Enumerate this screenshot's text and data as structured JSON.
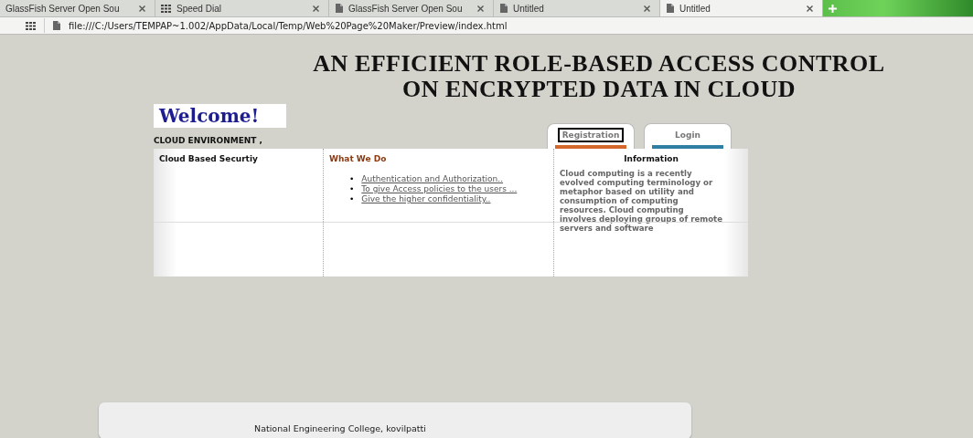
{
  "browser": {
    "tabs": [
      {
        "label": "GlassFish Server Open Sou",
        "kind": "plain",
        "selected": false
      },
      {
        "label": "Speed Dial",
        "kind": "dial",
        "selected": false
      },
      {
        "label": "GlassFish Server Open Sou",
        "kind": "page",
        "selected": false
      },
      {
        "label": "Untitled",
        "kind": "page",
        "selected": false
      },
      {
        "label": "Untitled",
        "kind": "page",
        "selected": true
      }
    ],
    "address": "file:///C:/Users/TEMPAP~1.002/AppData/Local/Temp/Web%20Page%20Maker/Preview/index.html"
  },
  "page": {
    "title_lines": [
      "AN EFFICIENT ROLE-BASED ACCESS CONTROL",
      "ON ENCRYPTED DATA IN CLOUD"
    ],
    "welcome": "Welcome!",
    "subtitle": "CLOUD ENVIRONMENT ,",
    "nav_tabs": [
      {
        "label": "Registration",
        "selected": true
      },
      {
        "label": "Login",
        "selected": false
      }
    ],
    "columns": [
      {
        "heading": "Cloud Based Securtiy"
      },
      {
        "heading": "What We Do",
        "links": [
          {
            "bullet": "•",
            "text": "Authentication and Authorization.."
          },
          {
            "bullet": "•",
            "text": "To give Access policies to the users ..."
          },
          {
            "bullet": "•",
            "text": "Give the higher confidentiality.."
          }
        ]
      },
      {
        "heading": "Information",
        "text": "Cloud computing is a recently evolved computing terminology or metaphor based on utility and consumption of computing resources. Cloud computing involves deploying groups of remote servers and software"
      }
    ],
    "footer": "National Engineering College, kovilpatti"
  }
}
